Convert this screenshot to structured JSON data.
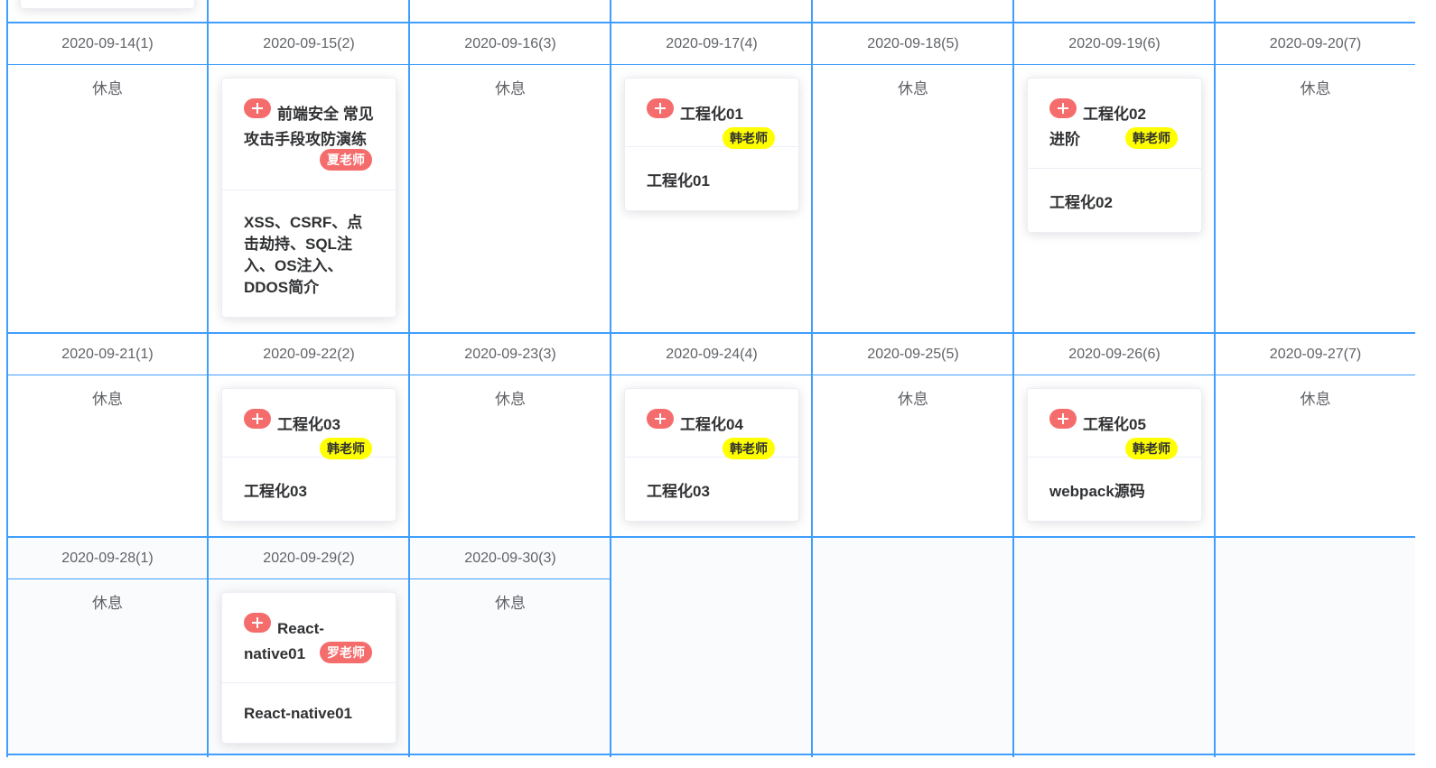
{
  "colors": {
    "grid": "#409eff",
    "plus_button": "#f56c6c",
    "teacher_tag_yellow": "#ffff00",
    "teacher_tag_red": "#f56c6c",
    "empty_cell_bg": "#fafbfd"
  },
  "calendar": {
    "rest_label": "休息",
    "weeks": [
      {
        "days": [
          {
            "date": "2020-09-14(1)",
            "rest": true
          },
          {
            "date": "2020-09-15(2)",
            "rest": false,
            "course": {
              "title": "前端安全 常见攻击手段攻防演练",
              "teacher": "夏老师",
              "tag_color": "red",
              "content": "XSS、CSRF、点击劫持、SQL注入、OS注入、DDOS简介"
            }
          },
          {
            "date": "2020-09-16(3)",
            "rest": true
          },
          {
            "date": "2020-09-17(4)",
            "rest": false,
            "course": {
              "title": "工程化01",
              "teacher": "韩老师",
              "tag_color": "yellow",
              "content": "工程化01"
            }
          },
          {
            "date": "2020-09-18(5)",
            "rest": true
          },
          {
            "date": "2020-09-19(6)",
            "rest": false,
            "course": {
              "title": "工程化02 进阶",
              "teacher": "韩老师",
              "tag_color": "yellow",
              "content": "工程化02"
            }
          },
          {
            "date": "2020-09-20(7)",
            "rest": true
          }
        ]
      },
      {
        "days": [
          {
            "date": "2020-09-21(1)",
            "rest": true
          },
          {
            "date": "2020-09-22(2)",
            "rest": false,
            "course": {
              "title": "工程化03",
              "teacher": "韩老师",
              "tag_color": "yellow",
              "content": "工程化03"
            }
          },
          {
            "date": "2020-09-23(3)",
            "rest": true
          },
          {
            "date": "2020-09-24(4)",
            "rest": false,
            "course": {
              "title": "工程化04",
              "teacher": "韩老师",
              "tag_color": "yellow",
              "content": "工程化03"
            }
          },
          {
            "date": "2020-09-25(5)",
            "rest": true
          },
          {
            "date": "2020-09-26(6)",
            "rest": false,
            "course": {
              "title": "工程化05",
              "teacher": "韩老师",
              "tag_color": "yellow",
              "content": "webpack源码"
            }
          },
          {
            "date": "2020-09-27(7)",
            "rest": true
          }
        ]
      },
      {
        "days": [
          {
            "date": "2020-09-28(1)",
            "rest": true
          },
          {
            "date": "2020-09-29(2)",
            "rest": false,
            "course": {
              "title": "React-native01",
              "teacher": "罗老师",
              "tag_color": "red",
              "content": "React-native01"
            }
          },
          {
            "date": "2020-09-30(3)",
            "rest": true
          },
          null,
          null,
          null,
          null
        ]
      }
    ]
  }
}
